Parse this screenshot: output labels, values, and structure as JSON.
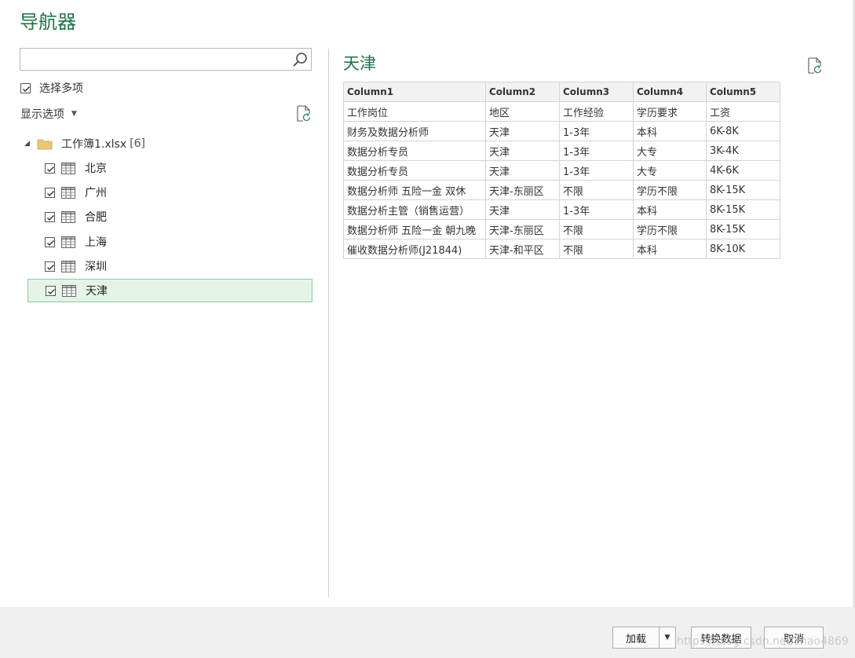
{
  "dialog": {
    "title": "导航器"
  },
  "search": {
    "value": "",
    "placeholder": ""
  },
  "multi_select": {
    "label": "选择多项",
    "checked": true
  },
  "display_options": {
    "label": "显示选项"
  },
  "tree": {
    "root": {
      "label": "工作簿1.xlsx",
      "count": "[6]"
    },
    "items": [
      {
        "label": "北京",
        "checked": true,
        "selected": false
      },
      {
        "label": "广州",
        "checked": true,
        "selected": false
      },
      {
        "label": "合肥",
        "checked": true,
        "selected": false
      },
      {
        "label": "上海",
        "checked": true,
        "selected": false
      },
      {
        "label": "深圳",
        "checked": true,
        "selected": false
      },
      {
        "label": "天津",
        "checked": true,
        "selected": true
      }
    ]
  },
  "preview": {
    "title": "天津",
    "columns": [
      "Column1",
      "Column2",
      "Column3",
      "Column4",
      "Column5"
    ],
    "rows": [
      [
        "工作岗位",
        "地区",
        "工作经验",
        "学历要求",
        "工资"
      ],
      [
        "财务及数据分析师",
        "天津",
        "1-3年",
        "本科",
        "6K-8K"
      ],
      [
        "数据分析专员",
        "天津",
        "1-3年",
        "大专",
        "3K-4K"
      ],
      [
        "数据分析专员",
        "天津",
        "1-3年",
        "大专",
        "4K-6K"
      ],
      [
        "数据分析师 五险一金 双休",
        "天津-东丽区",
        "不限",
        "学历不限",
        "8K-15K"
      ],
      [
        "数据分析主管（销售运营）",
        "天津",
        "1-3年",
        "本科",
        "8K-15K"
      ],
      [
        "数据分析师 五险一金 朝九晚",
        "天津-东丽区",
        "不限",
        "学历不限",
        "8K-15K"
      ],
      [
        "催收数据分析师(J21844)",
        "天津-和平区",
        "不限",
        "本科",
        "8K-10K"
      ]
    ]
  },
  "buttons": {
    "load": "加载",
    "transform": "转换数据",
    "cancel": "取消"
  },
  "watermark": "https://blog.csdn.net/zhao4869",
  "colors": {
    "accent": "#217346",
    "selected_bg": "#e5f4e9",
    "selected_border": "#8fc89f"
  }
}
